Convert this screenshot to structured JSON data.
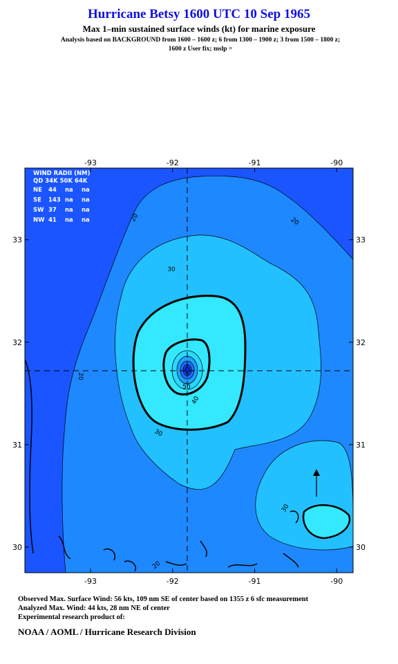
{
  "header": {
    "title": "Hurricane Betsy 1600 UTC 10 Sep 1965",
    "subtitle": "Max 1–min sustained surface winds (kt) for marine exposure",
    "analysis_line1": "Analysis based on  BACKGROUND from 1600 – 1600 z;  6 from 1300 – 1900 z;  3 from 1500 – 1800 z;",
    "analysis_line2": "1600 z User fix; mslp ="
  },
  "map": {
    "lon_ticks": [
      "-93",
      "-92",
      "-91",
      "-90"
    ],
    "lat_ticks": [
      "33",
      "32",
      "31",
      "30"
    ],
    "lon_range": [
      -93.8,
      -89.8
    ],
    "lat_range": [
      29.75,
      33.7
    ],
    "center": {
      "lon": -91.8,
      "lat": 31.7
    },
    "contour_labels": [
      "20",
      "20",
      "20",
      "20",
      "30",
      "30",
      "30",
      "40",
      "50"
    ],
    "colors": {
      "outer": "#1a55ff",
      "level20": "#1e88ff",
      "level30": "#22c0ff",
      "level40": "#33e8ff",
      "core": "#0a2acc"
    }
  },
  "wind_radii": {
    "header1": "WIND RADII (NM)",
    "header2": "QD 34K 50K 64K",
    "rows": [
      {
        "qd": "NE",
        "r34": "44",
        "r50": "na",
        "r64": "na"
      },
      {
        "qd": "SE",
        "r34": "143",
        "r50": "na",
        "r64": "na"
      },
      {
        "qd": "SW",
        "r34": "37",
        "r50": "na",
        "r64": "na"
      },
      {
        "qd": "NW",
        "r34": "41",
        "r50": "na",
        "r64": "na"
      }
    ]
  },
  "footer": {
    "observed": "Observed Max. Surface Wind: 56 kts, 109 nm SE of center based on 1355 z 6 sfc measurement",
    "analyzed": "Analyzed Max. Wind: 44 kts, 28 nm NE of center",
    "product": "Experimental research product of:",
    "org": "NOAA / AOML / Hurricane Research Division"
  }
}
